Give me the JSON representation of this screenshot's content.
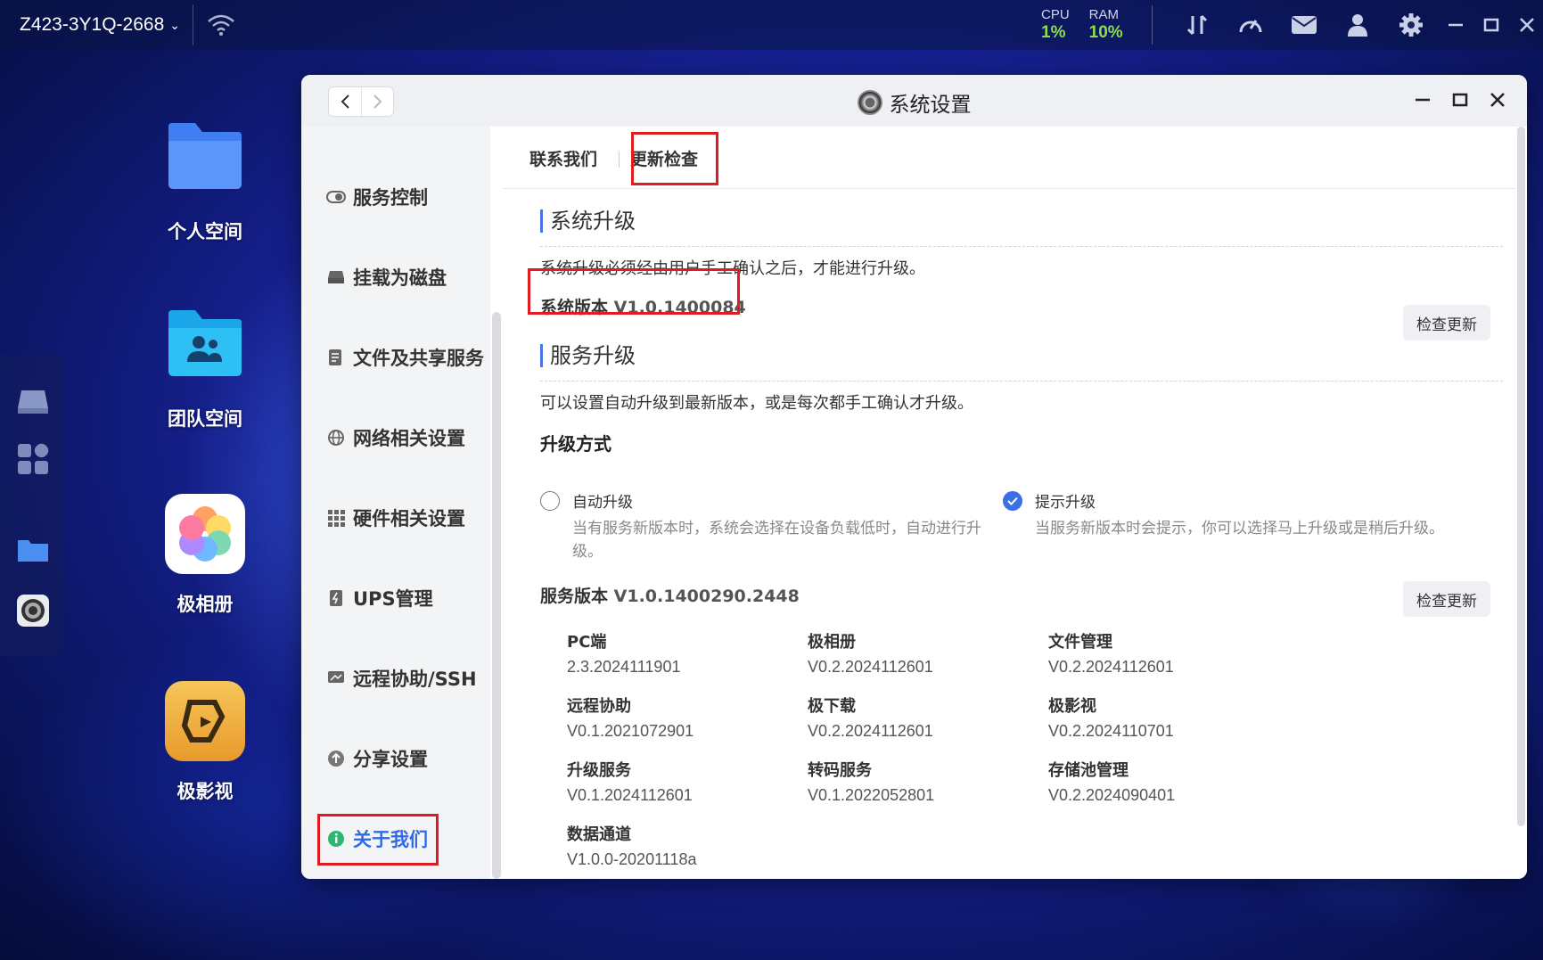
{
  "topbar": {
    "device_name": "Z423-3Y1Q-2668",
    "cpu_label": "CPU",
    "cpu_value": "1%",
    "ram_label": "RAM",
    "ram_value": "10%",
    "icons": [
      "transfer-icon",
      "speedometer-icon",
      "mail-icon",
      "user-icon",
      "gear-icon",
      "minimize-icon",
      "maximize-icon",
      "close-icon"
    ]
  },
  "desktop": {
    "icons": [
      {
        "label": "个人空间",
        "icon": "folder-icon"
      },
      {
        "label": "团队空间",
        "icon": "team-folder-icon"
      },
      {
        "label": "极相册",
        "icon": "photos-icon"
      },
      {
        "label": "极影视",
        "icon": "video-icon"
      }
    ]
  },
  "window": {
    "title": "系统设置",
    "sidebar": {
      "items": [
        {
          "label": "服务控制",
          "icon": "toggle-icon"
        },
        {
          "label": "挂载为磁盘",
          "icon": "disk-icon"
        },
        {
          "label": "文件及共享服务",
          "icon": "file-share-icon"
        },
        {
          "label": "网络相关设置",
          "icon": "globe-icon"
        },
        {
          "label": "硬件相关设置",
          "icon": "grid-icon"
        },
        {
          "label": "UPS管理",
          "icon": "ups-icon"
        },
        {
          "label": "远程协助/SSH",
          "icon": "remote-icon"
        },
        {
          "label": "分享设置",
          "icon": "share-icon"
        },
        {
          "label": "关于我们",
          "icon": "info-icon",
          "active": true
        }
      ]
    },
    "tabs": [
      "联系我们",
      "更新检查"
    ],
    "active_tab": "更新检查",
    "system_upgrade": {
      "title": "系统升级",
      "desc": "系统升级必须经由用户手工确认之后，才能进行升级。",
      "version_label": "系统版本",
      "version_value": "V1.0.1400084",
      "check_button": "检查更新"
    },
    "service_upgrade": {
      "title": "服务升级",
      "desc": "可以设置自动升级到最新版本，或是每次都手工确认才升级。",
      "mode_label": "升级方式",
      "options": [
        {
          "title": "自动升级",
          "desc": "当有服务新版本时，系统会选择在设备负载低时，自动进行升级。",
          "selected": false
        },
        {
          "title": "提示升级",
          "desc": "当服务新版本时会提示，你可以选择马上升级或是稍后升级。",
          "selected": true
        }
      ],
      "version_label": "服务版本",
      "version_value": "V1.0.1400290.2448",
      "check_button": "检查更新",
      "services": [
        {
          "name": "PC端",
          "version": "2.3.2024111901"
        },
        {
          "name": "极相册",
          "version": "V0.2.2024112601"
        },
        {
          "name": "文件管理",
          "version": "V0.2.2024112601"
        },
        {
          "name": "远程协助",
          "version": "V0.1.2021072901"
        },
        {
          "name": "极下载",
          "version": "V0.2.2024112601"
        },
        {
          "name": "极影视",
          "version": "V0.2.2024110701"
        },
        {
          "name": "升级服务",
          "version": "V0.1.2024112601"
        },
        {
          "name": "转码服务",
          "version": "V0.1.2022052801"
        },
        {
          "name": "存储池管理",
          "version": "V0.2.2024090401"
        },
        {
          "name": "数据通道",
          "version": "V1.0.0-20201118a"
        }
      ]
    }
  },
  "colors": {
    "accent": "#2f6be8",
    "highlight_box": "#e21b23",
    "stat_green": "#8be04a"
  }
}
